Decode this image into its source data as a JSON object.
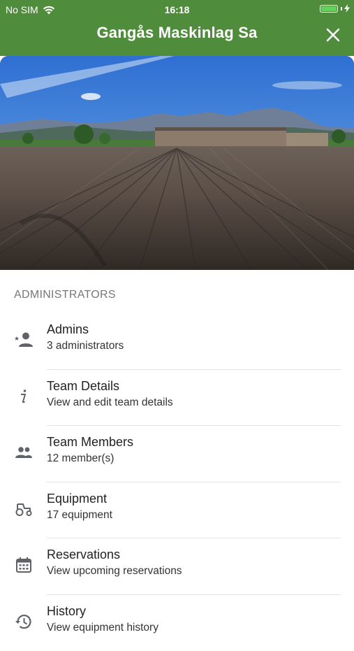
{
  "status_bar": {
    "carrier": "No SIM",
    "time": "16:18"
  },
  "nav": {
    "title": "Gangås Maskinlag Sa"
  },
  "section": {
    "header": "ADMINISTRATORS"
  },
  "items": [
    {
      "title": "Admins",
      "subtitle": "3 administrators",
      "icon": "admin-person-icon"
    },
    {
      "title": "Team Details",
      "subtitle": "View and edit team details",
      "icon": "info-icon"
    },
    {
      "title": "Team Members",
      "subtitle": "12 member(s)",
      "icon": "people-icon"
    },
    {
      "title": "Equipment",
      "subtitle": "17 equipment",
      "icon": "tractor-icon"
    },
    {
      "title": "Reservations",
      "subtitle": "View upcoming reservations",
      "icon": "calendar-icon"
    },
    {
      "title": "History",
      "subtitle": "View equipment history",
      "icon": "history-icon"
    }
  ],
  "colors": {
    "header": "#4f8c3c",
    "icon": "#5f6368"
  }
}
